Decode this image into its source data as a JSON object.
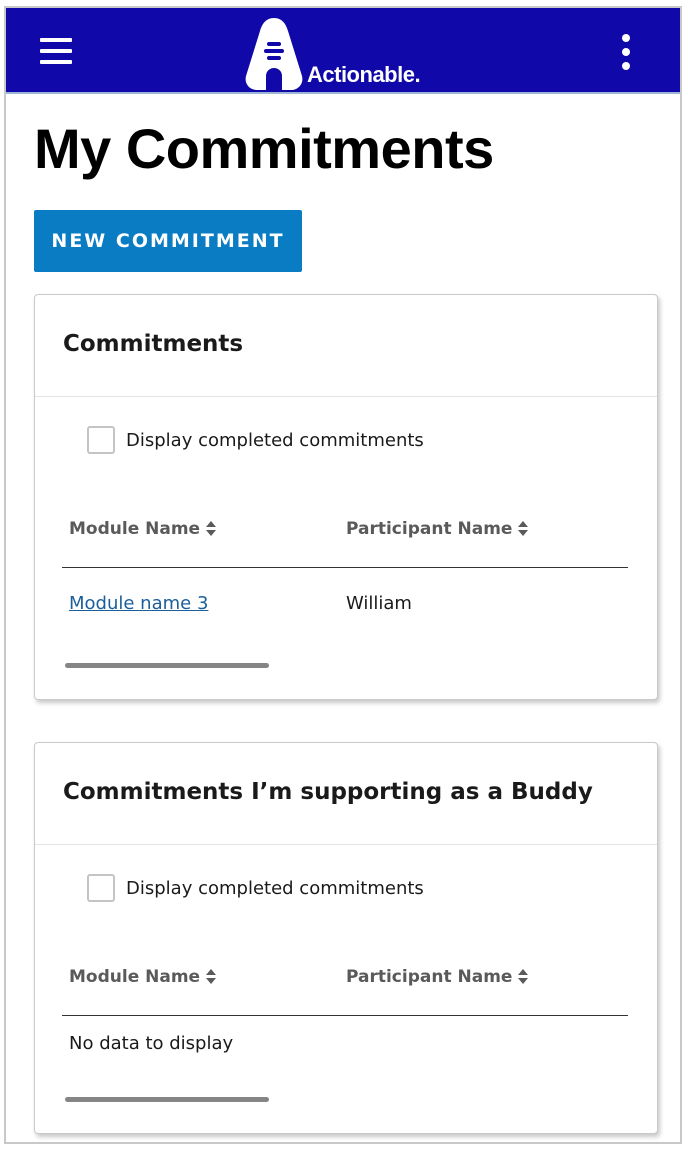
{
  "header": {
    "menu_icon": "hamburger-menu-icon",
    "logo_text": "Actionable.",
    "more_icon": "kebab-more-icon",
    "bar_color": "#1008a8"
  },
  "page": {
    "title": "My Commitments",
    "new_button_label": "NEW COMMITMENT",
    "accent_color": "#0a7cc4"
  },
  "sections": [
    {
      "title": "Commitments",
      "checkbox_label": "Display completed commitments",
      "checkbox_checked": false,
      "columns": [
        "Module Name",
        "Participant Name"
      ],
      "rows": [
        {
          "module": "Module name 3",
          "participant": "William"
        }
      ],
      "empty_text": ""
    },
    {
      "title": "Commitments I’m supporting as a Buddy",
      "checkbox_label": "Display completed commitments",
      "checkbox_checked": false,
      "columns": [
        "Module Name",
        "Participant Name"
      ],
      "rows": [],
      "empty_text": "No data to display"
    }
  ]
}
